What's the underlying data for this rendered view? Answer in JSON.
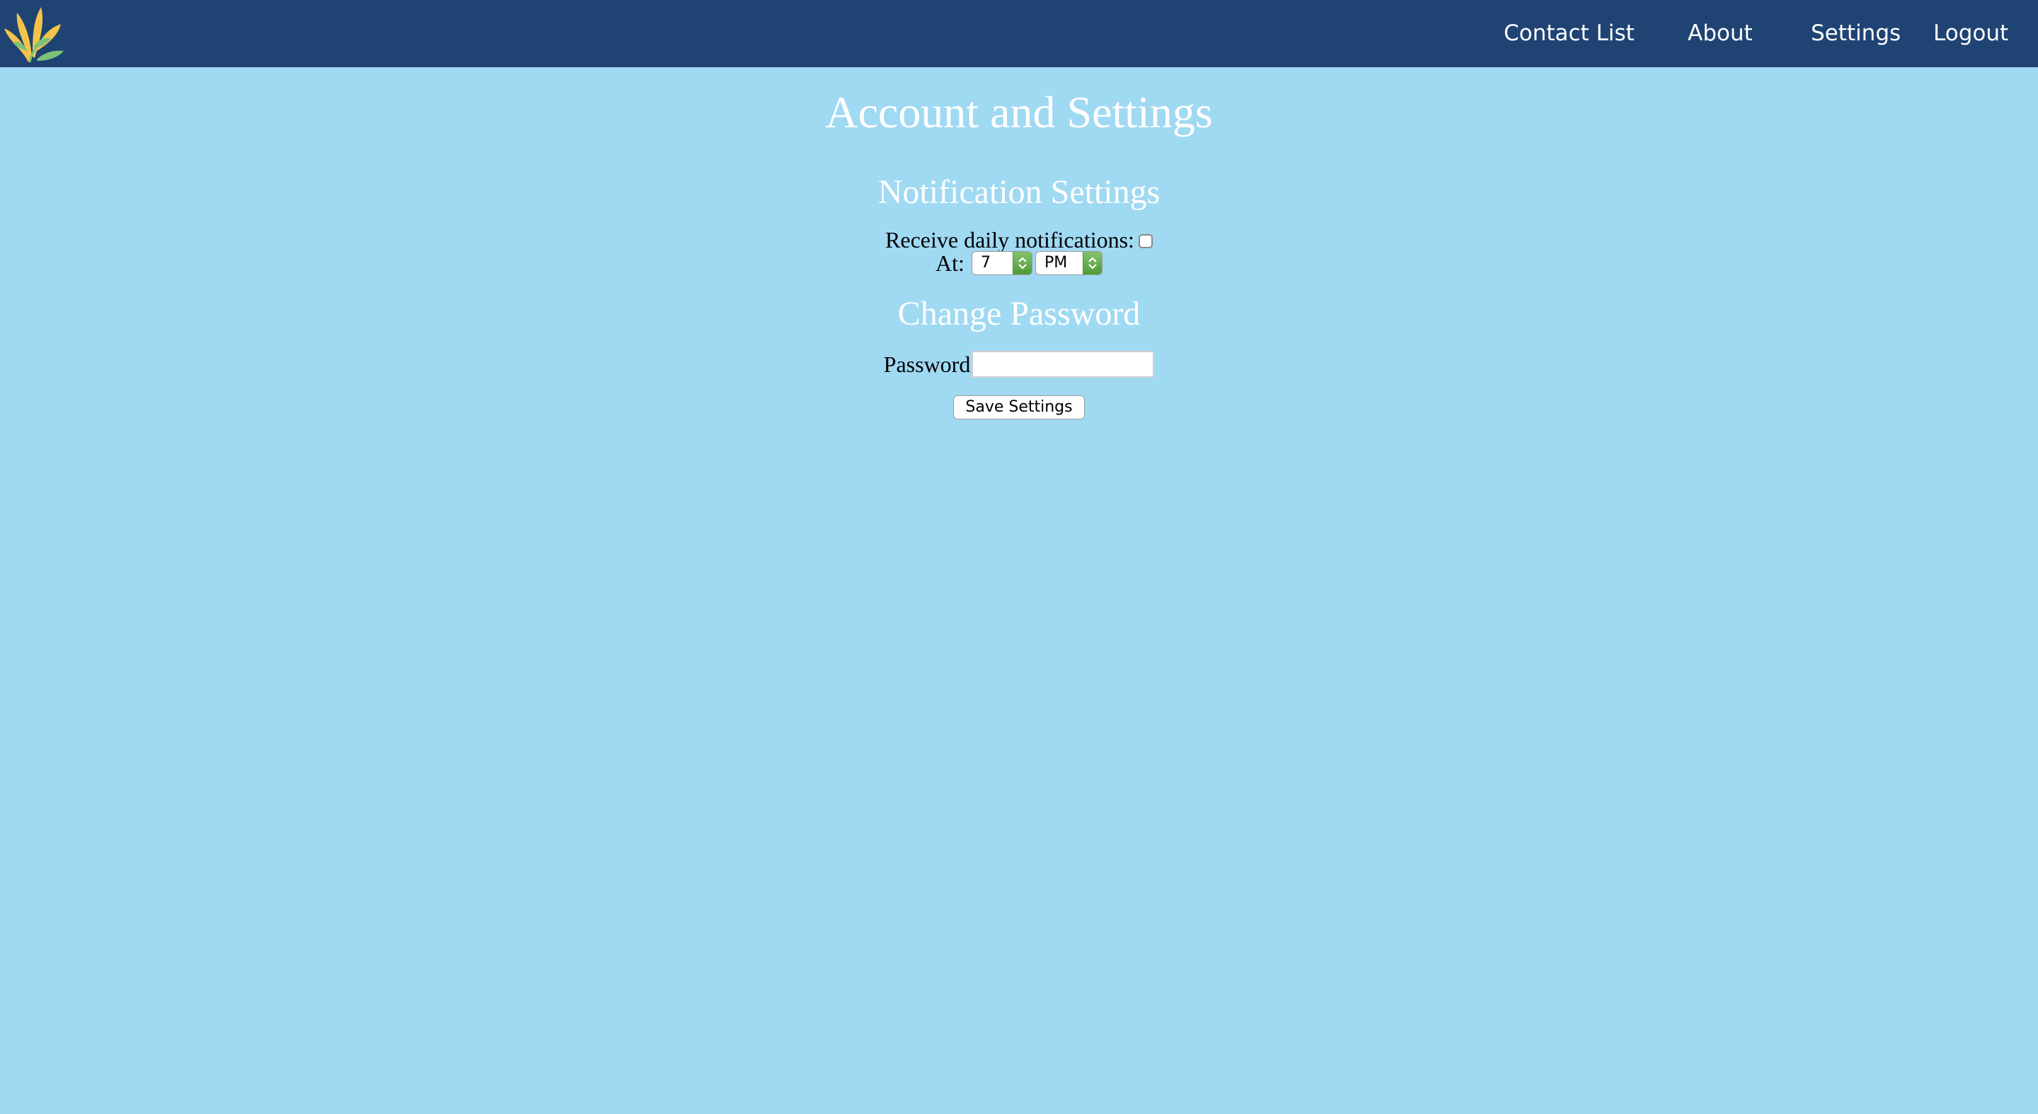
{
  "navbar": {
    "logo_icon": "flower-leaf-logo-icon",
    "links": {
      "contact_list": "Contact List",
      "about": "About",
      "settings": "Settings",
      "logout": "Logout"
    },
    "background_color": "#1f4373"
  },
  "page": {
    "title": "Account and Settings",
    "background_color": "#a0d9f2"
  },
  "notifications": {
    "heading": "Notification Settings",
    "daily_label": "Receive daily notifications:",
    "daily_checked": false,
    "at_label": "At:",
    "hour_value": "7",
    "ampm_value": "PM"
  },
  "password": {
    "heading": "Change Password",
    "label": "Password",
    "value": ""
  },
  "actions": {
    "save_label": "Save Settings"
  }
}
